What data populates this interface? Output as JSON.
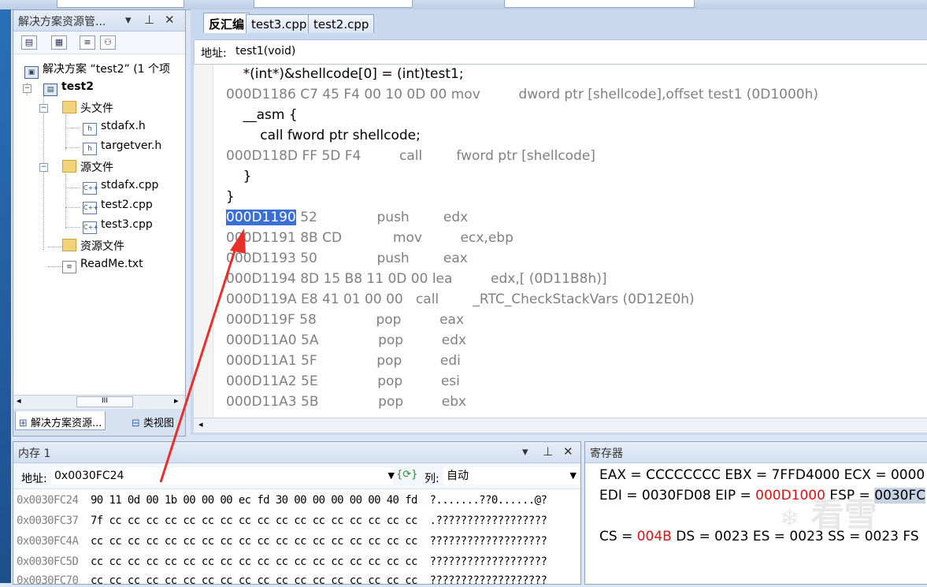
{
  "solution_explorer": {
    "title": "解决方案资源管...",
    "tree": [
      {
        "label": "解决方案 “test2” (1 个项",
        "icon": "solution-icon"
      },
      {
        "label": "test2",
        "icon": "project-icon"
      },
      {
        "label": "头文件",
        "icon": "folder-icon"
      },
      {
        "label": "stdafx.h",
        "icon": "header-file-icon"
      },
      {
        "label": "targetver.h",
        "icon": "header-file-icon"
      },
      {
        "label": "源文件",
        "icon": "folder-icon"
      },
      {
        "label": "stdafx.cpp",
        "icon": "cpp-file-icon"
      },
      {
        "label": "test2.cpp",
        "icon": "cpp-file-icon"
      },
      {
        "label": "test3.cpp",
        "icon": "cpp-file-icon"
      },
      {
        "label": "资源文件",
        "icon": "folder-icon"
      },
      {
        "label": "ReadMe.txt",
        "icon": "text-file-icon"
      }
    ],
    "bottom_tabs": [
      "解决方案资源...",
      "类视图"
    ],
    "scroll_grip": "III"
  },
  "editor": {
    "tabs": [
      "反汇编",
      "test3.cpp",
      "test2.cpp"
    ],
    "address_label": "地址:",
    "address_value": "test1(void)",
    "lines": [
      {
        "text": "    *(int*)&shellcode[0] = (int)test1;",
        "gray": false
      },
      {
        "text": "000D1186 C7 45 F4 00 10 0D 00 mov         dword ptr [shellcode],offset test1 (0D1000h)",
        "gray": true
      },
      {
        "text": "    __asm {",
        "gray": false
      },
      {
        "text": "        call fword ptr shellcode;",
        "gray": false
      },
      {
        "text": "000D118D FF 5D F4         call        fword ptr [shellcode]",
        "gray": true
      },
      {
        "text": "    }",
        "gray": false
      },
      {
        "text": "}",
        "gray": false
      },
      {
        "text": " 52              push        edx",
        "gray": true,
        "highlight": "000D1190"
      },
      {
        "text": "000D1191 8B CD            mov         ecx,ebp",
        "gray": true
      },
      {
        "text": "000D1193 50              push        eax",
        "gray": true
      },
      {
        "text": "000D1194 8D 15 B8 11 0D 00 lea         edx,[ (0D11B8h)]",
        "gray": true
      },
      {
        "text": "000D119A E8 41 01 00 00   call        _RTC_CheckStackVars (0D12E0h)",
        "gray": true
      },
      {
        "text": "000D119F 58              pop         eax",
        "gray": true
      },
      {
        "text": "000D11A0 5A              pop         edx",
        "gray": true
      },
      {
        "text": "000D11A1 5F              pop         edi",
        "gray": true
      },
      {
        "text": "000D11A2 5E              pop         esi",
        "gray": true
      },
      {
        "text": "000D11A3 5B              pop         ebx",
        "gray": true
      }
    ]
  },
  "memory": {
    "title": "内存 1",
    "address_label": "地址:",
    "address_value": "0x0030FC24",
    "refresh_icon": "refresh-icon",
    "columns_label": "列:",
    "columns_value": "自动",
    "rows": [
      {
        "addr": "0x0030FC24",
        "data": "  90 11 0d 00 1b 00 00 00 ec fd 30 00 00 00 00 00 40 fd  ?.......??0......@?"
      },
      {
        "addr": "0x0030FC37",
        "data": "  7f cc cc cc cc cc cc cc cc cc cc cc cc cc cc cc cc cc  .??????????????????"
      },
      {
        "addr": "0x0030FC4A",
        "data": "  cc cc cc cc cc cc cc cc cc cc cc cc cc cc cc cc cc cc  ???????????????????"
      },
      {
        "addr": "0x0030FC5D",
        "data": "  cc cc cc cc cc cc cc cc cc cc cc cc cc cc cc cc cc cc  ???????????????????"
      },
      {
        "addr": "0x0030FC70",
        "data": "  cc cc cc cc cc cc cc cc cc cc cc cc cc cc cc cc cc cc  ???????????????????"
      }
    ]
  },
  "registers": {
    "title": "寄存器",
    "line1": "EAX = CCCCCCCC EBX = 7FFD4000 ECX = 0000",
    "line2_prefix": "EDI = 0030FD08 EIP = ",
    "line2_eip": "000D1000",
    "line2_mid": " ESP = ",
    "line2_esp": "0030FC",
    "line3_prefix": "CS = ",
    "line3_cs": "004B",
    "line3_rest": " DS = 0023 ES = 0023 SS = 0023 FS"
  },
  "watermark": "看雪",
  "colors": {
    "highlight": "#3b6fd6",
    "changed_register": "#e01010",
    "annotation_arrow": "#e8302a"
  }
}
